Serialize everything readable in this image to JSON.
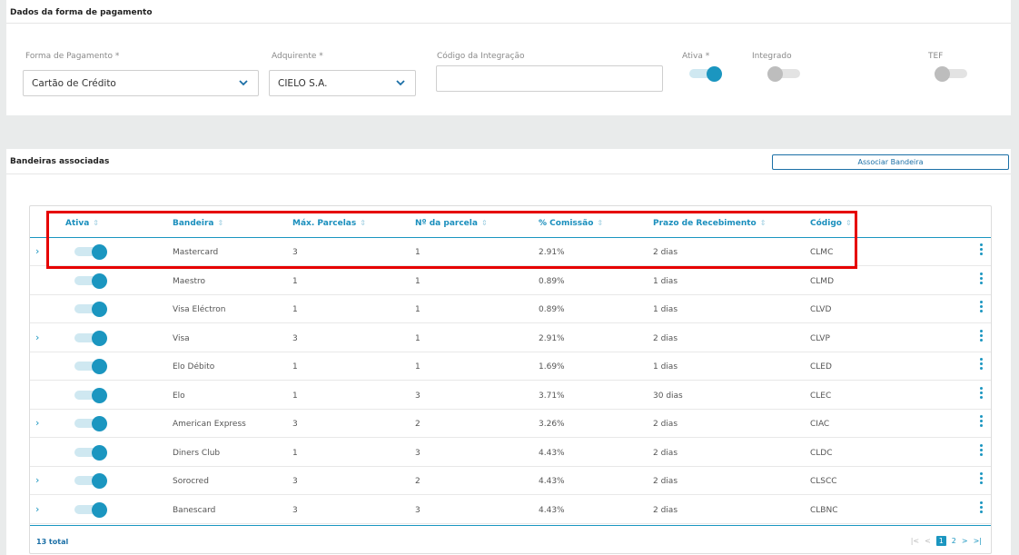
{
  "payment_section": {
    "title": "Dados da forma de pagamento",
    "fields": {
      "forma_label": "Forma de Pagamento *",
      "forma_value": "Cartão de Crédito",
      "adquirente_label": "Adquirente *",
      "adquirente_value": "CIELO S.A.",
      "codigo_label": "Código da Integração",
      "codigo_value": "",
      "ativa_label": "Ativa *",
      "ativa_on": true,
      "integrado_label": "Integrado",
      "integrado_on": false,
      "tef_label": "TEF",
      "tef_on": false
    }
  },
  "bandeiras_section": {
    "title": "Bandeiras associadas",
    "associate_button": "Associar Bandeira",
    "columns": [
      "Ativa",
      "Bandeira",
      "Máx. Parcelas",
      "Nº da parcela",
      "% Comissão",
      "Prazo de Recebimento",
      "Código"
    ],
    "rows": [
      {
        "expandable": true,
        "active": true,
        "bandeira": "Mastercard",
        "max": "3",
        "parcela": "1",
        "comissao": "2.91%",
        "prazo": "2 dias",
        "codigo": "CLMC"
      },
      {
        "expandable": false,
        "active": true,
        "bandeira": "Maestro",
        "max": "1",
        "parcela": "1",
        "comissao": "0.89%",
        "prazo": "1 dias",
        "codigo": "CLMD"
      },
      {
        "expandable": false,
        "active": true,
        "bandeira": "Visa Eléctron",
        "max": "1",
        "parcela": "1",
        "comissao": "0.89%",
        "prazo": "1 dias",
        "codigo": "CLVD"
      },
      {
        "expandable": true,
        "active": true,
        "bandeira": "Visa",
        "max": "3",
        "parcela": "1",
        "comissao": "2.91%",
        "prazo": "2 dias",
        "codigo": "CLVP"
      },
      {
        "expandable": false,
        "active": true,
        "bandeira": "Elo Débito",
        "max": "1",
        "parcela": "1",
        "comissao": "1.69%",
        "prazo": "1 dias",
        "codigo": "CLED"
      },
      {
        "expandable": false,
        "active": true,
        "bandeira": "Elo",
        "max": "1",
        "parcela": "3",
        "comissao": "3.71%",
        "prazo": "30 dias",
        "codigo": "CLEC"
      },
      {
        "expandable": true,
        "active": true,
        "bandeira": "American Express",
        "max": "3",
        "parcela": "2",
        "comissao": "3.26%",
        "prazo": "2 dias",
        "codigo": "CIAC"
      },
      {
        "expandable": false,
        "active": true,
        "bandeira": "Diners Club",
        "max": "1",
        "parcela": "3",
        "comissao": "4.43%",
        "prazo": "2 dias",
        "codigo": "CLDC"
      },
      {
        "expandable": true,
        "active": true,
        "bandeira": "Sorocred",
        "max": "3",
        "parcela": "2",
        "comissao": "4.43%",
        "prazo": "2 dias",
        "codigo": "CLSCC"
      },
      {
        "expandable": true,
        "active": true,
        "bandeira": "Banescard",
        "max": "3",
        "parcela": "3",
        "comissao": "4.43%",
        "prazo": "2 dias",
        "codigo": "CLBNC"
      }
    ],
    "total_label": "13 total",
    "pagination": {
      "current": "1",
      "next": "2"
    }
  },
  "colors": {
    "accent": "#1b96c0",
    "highlight": "#e60000"
  },
  "icons": {
    "select": "chevron-down-icon",
    "expand": "chevron-right-icon",
    "row_menu": "kebab-menu-icon",
    "sort": "sort-icon"
  }
}
